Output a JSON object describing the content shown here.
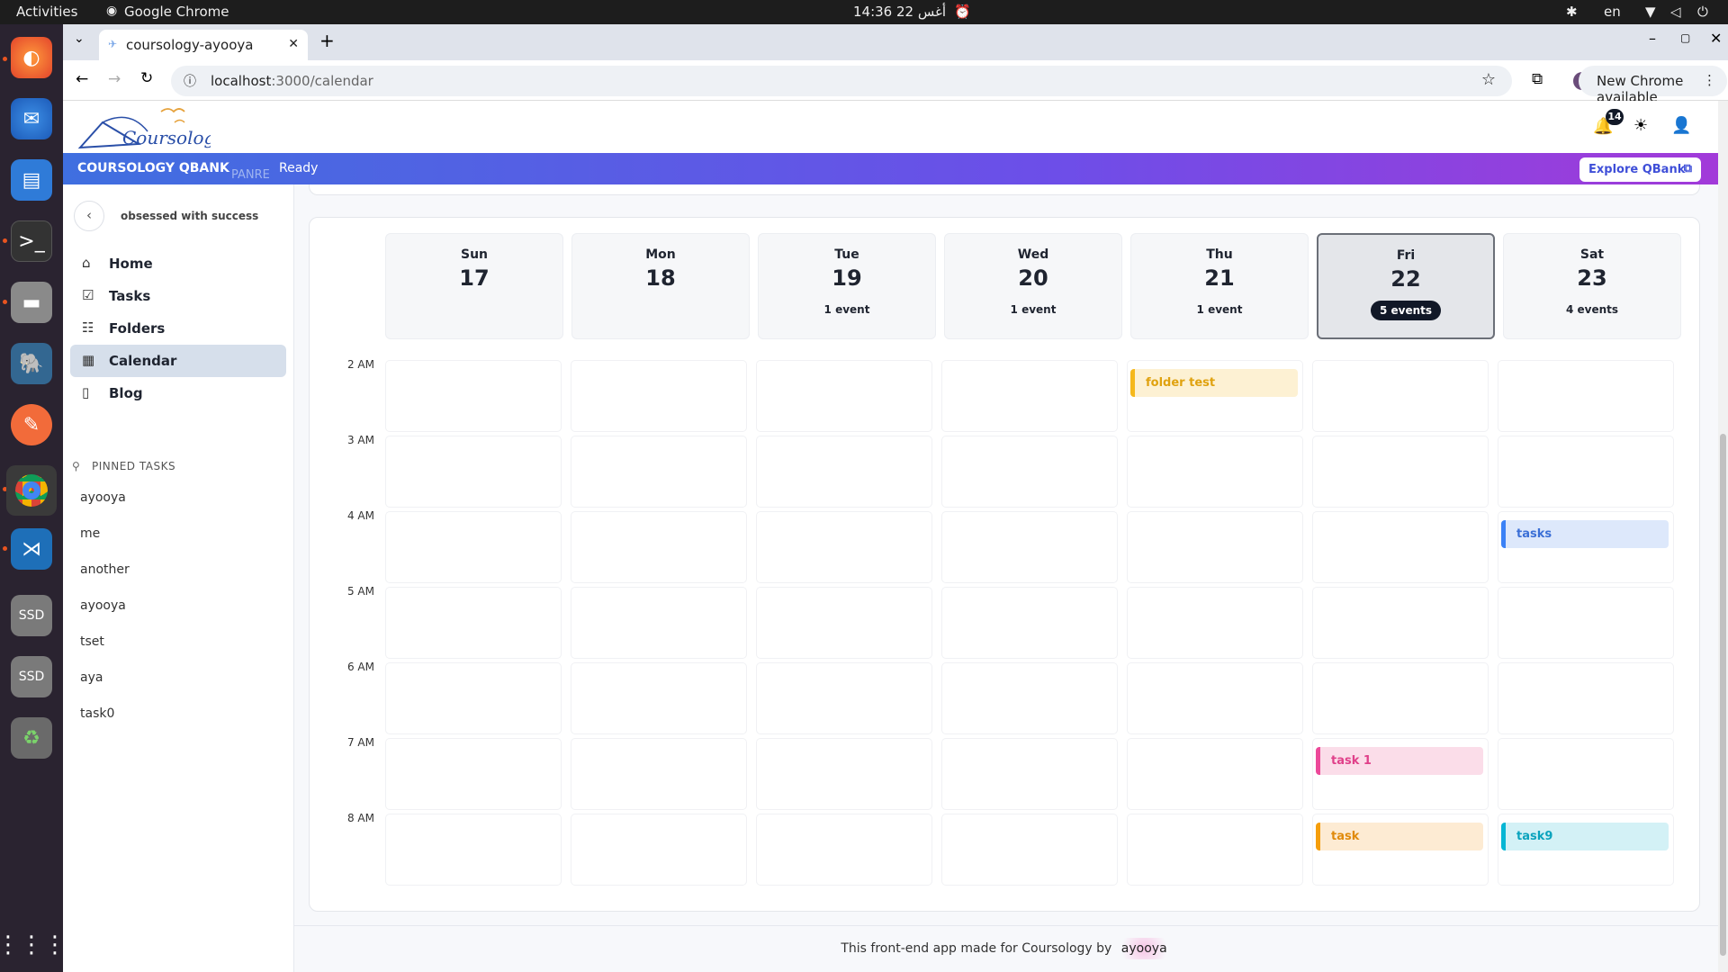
{
  "system": {
    "activities": "Activities",
    "app_name": "Google Chrome",
    "clock": "14:36  أغس 22",
    "lang": "en"
  },
  "browser": {
    "tab_title": "coursology-ayooya",
    "url_host": "localhost",
    "url_path": ":3000/calendar",
    "new_chrome": "New Chrome available"
  },
  "header": {
    "logo_text": "Coursology",
    "notification_count": "14"
  },
  "banner": {
    "brand": "COURSOLOGY QBANK",
    "tag": "PANRE",
    "status": "Ready",
    "explore": "Explore QBank"
  },
  "sidebar": {
    "subtitle": "obsessed with success",
    "nav": [
      {
        "label": "Home",
        "icon": "home-icon"
      },
      {
        "label": "Tasks",
        "icon": "tasks-icon"
      },
      {
        "label": "Folders",
        "icon": "folders-icon"
      },
      {
        "label": "Calendar",
        "icon": "calendar-icon"
      },
      {
        "label": "Blog",
        "icon": "blog-icon"
      }
    ],
    "pinned_heading": "PINNED TASKS",
    "pinned": [
      "ayooya",
      "me",
      "another",
      "ayooya",
      "tset",
      "aya",
      "task0"
    ]
  },
  "calendar": {
    "days": [
      {
        "name": "Sun",
        "date": "17",
        "events": ""
      },
      {
        "name": "Mon",
        "date": "18",
        "events": ""
      },
      {
        "name": "Tue",
        "date": "19",
        "events": "1 event"
      },
      {
        "name": "Wed",
        "date": "20",
        "events": "1 event"
      },
      {
        "name": "Thu",
        "date": "21",
        "events": "1 event"
      },
      {
        "name": "Fri",
        "date": "22",
        "events": "5 events"
      },
      {
        "name": "Sat",
        "date": "23",
        "events": "4 events"
      }
    ],
    "selected_day": "Fri",
    "hours": [
      "2 AM",
      "3 AM",
      "4 AM",
      "5 AM",
      "6 AM",
      "7 AM",
      "8 AM"
    ],
    "events": [
      {
        "title": "folder test",
        "day": "Thu",
        "hour": "2 AM",
        "color": "#f5b81c",
        "bg": "#fdf1d3",
        "text": "#e0a20f"
      },
      {
        "title": "tasks",
        "day": "Sat",
        "hour": "4 AM",
        "color": "#3b82f6",
        "bg": "#dde8fb",
        "text": "#3b6fd6"
      },
      {
        "title": "task 1",
        "day": "Fri",
        "hour": "7 AM",
        "color": "#ec4899",
        "bg": "#fbdde9",
        "text": "#e0408a"
      },
      {
        "title": "task",
        "day": "Fri",
        "hour": "8 AM",
        "color": "#f59e0b",
        "bg": "#fdebd3",
        "text": "#e08a0b"
      },
      {
        "title": "task9",
        "day": "Sat",
        "hour": "8 AM",
        "color": "#06b6d4",
        "bg": "#d3f1f6",
        "text": "#0aa3bd"
      }
    ]
  },
  "footer": {
    "text": "This front-end app made for Coursology by",
    "author": "ayooya"
  }
}
